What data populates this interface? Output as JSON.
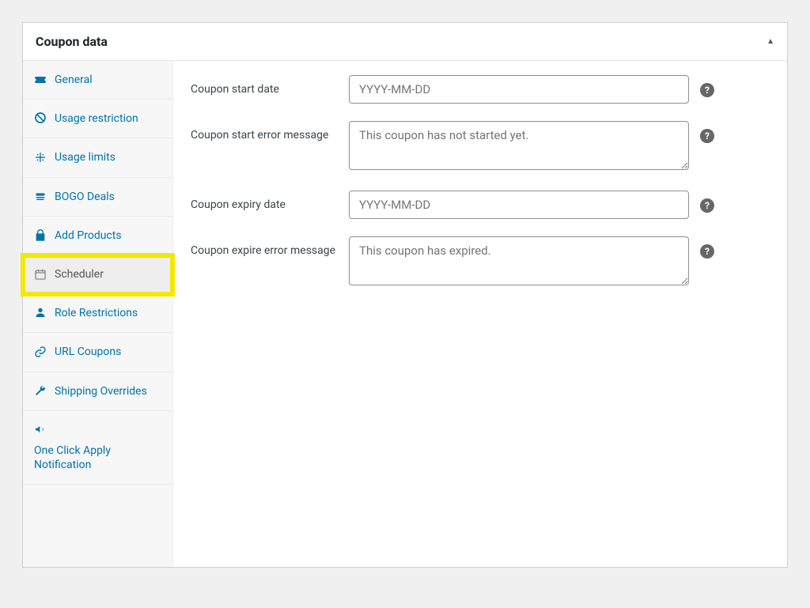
{
  "panel": {
    "title": "Coupon data"
  },
  "sidebar": {
    "items": [
      {
        "label": "General"
      },
      {
        "label": "Usage restriction"
      },
      {
        "label": "Usage limits"
      },
      {
        "label": "BOGO Deals"
      },
      {
        "label": "Add Products"
      },
      {
        "label": "Scheduler"
      },
      {
        "label": "Role Restrictions"
      },
      {
        "label": "URL Coupons"
      },
      {
        "label": "Shipping Overrides"
      },
      {
        "label": "One Click Apply Notification"
      }
    ]
  },
  "form": {
    "start_date": {
      "label": "Coupon start date",
      "placeholder": "YYYY-MM-DD",
      "value": ""
    },
    "start_error": {
      "label": "Coupon start error message",
      "placeholder": "This coupon has not started yet.",
      "value": ""
    },
    "expiry_date": {
      "label": "Coupon expiry date",
      "placeholder": "YYYY-MM-DD",
      "value": ""
    },
    "expire_error": {
      "label": "Coupon expire error message",
      "placeholder": "This coupon has expired.",
      "value": ""
    }
  }
}
